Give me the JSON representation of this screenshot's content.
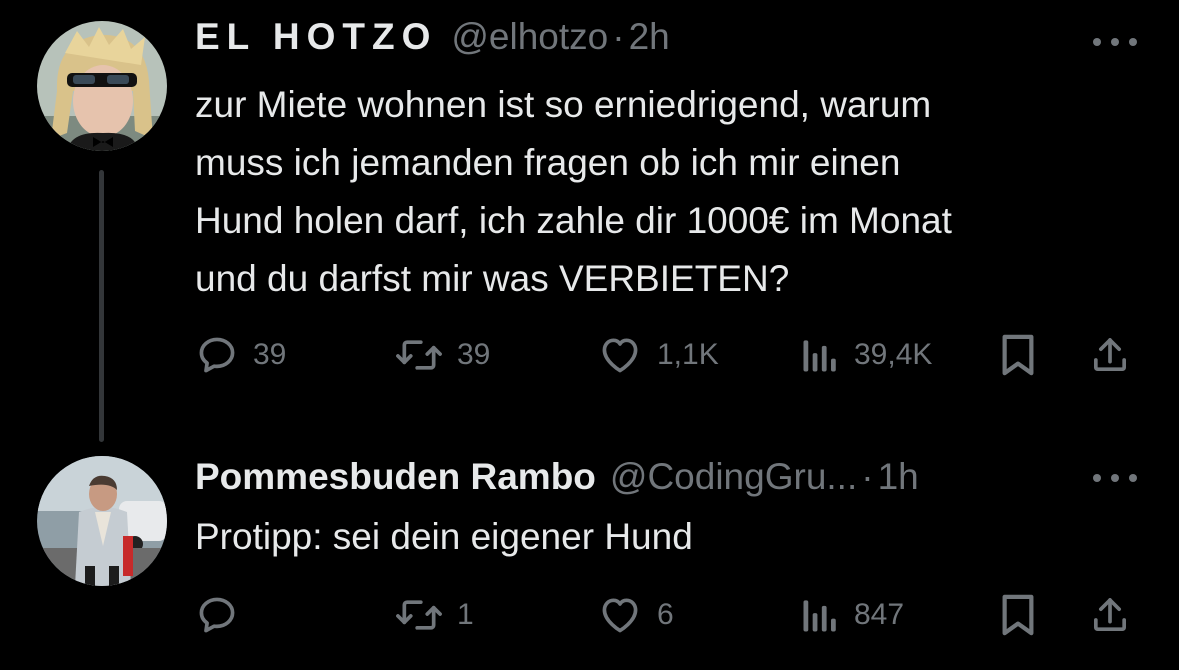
{
  "tweets": [
    {
      "author_name": "EL HOTZO",
      "handle": "@elhotzo",
      "separator": "·",
      "time": "2h",
      "lines": [
        "zur Miete wohnen ist so erniedrigend, warum",
        "muss ich jemanden fragen ob ich mir einen",
        "Hund holen darf, ich zahle dir 1000€ im Monat",
        "und du darfst mir was VERBIETEN?"
      ],
      "replies": "39",
      "reposts": "39",
      "likes": "1,1K",
      "views": "39,4K"
    },
    {
      "author_name": "Pommesbuden Rambo",
      "handle": "@CodingGru...",
      "separator": "·",
      "time": "1h",
      "lines": [
        "Protipp: sei dein eigener Hund"
      ],
      "replies": "",
      "reposts": "1",
      "likes": "6",
      "views": "847"
    }
  ],
  "colors": {
    "background": "#000000",
    "text": "#e7e9ea",
    "muted": "#71767b",
    "thread_line": "#333639"
  },
  "icons": [
    "reply-icon",
    "repost-icon",
    "like-icon",
    "views-icon",
    "bookmark-icon",
    "share-icon",
    "more-icon"
  ]
}
